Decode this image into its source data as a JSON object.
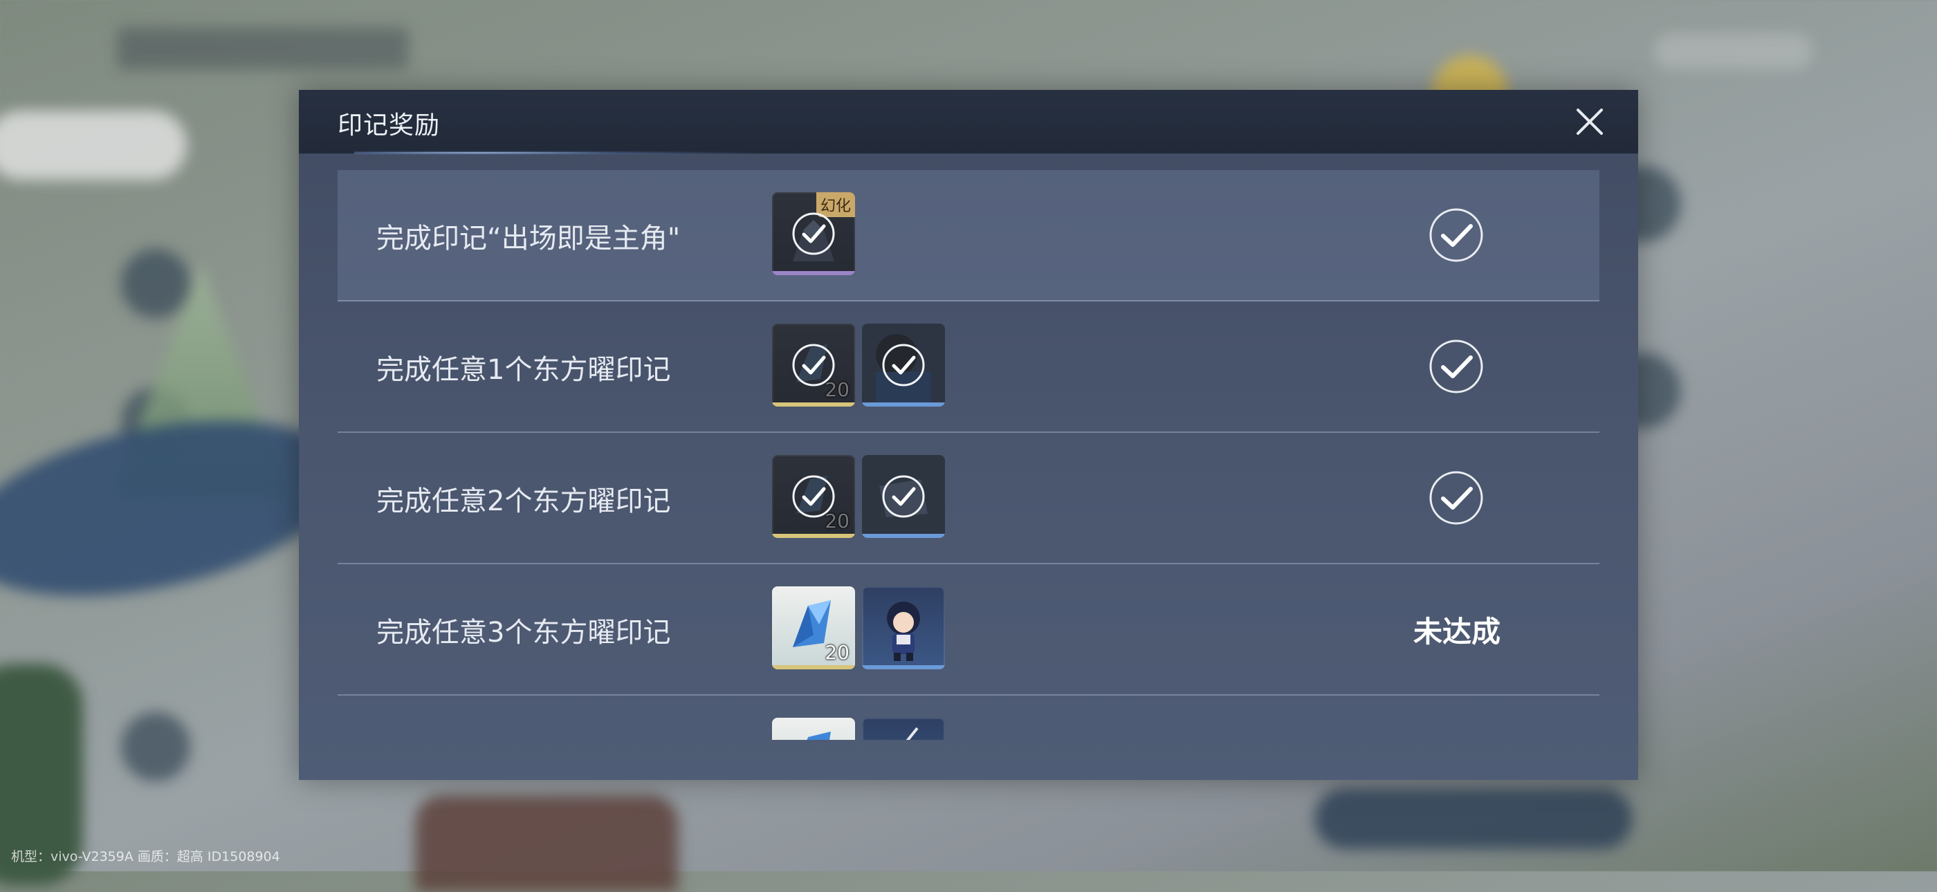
{
  "footer": {
    "meta": "机型：vivo-V2359A 画质：超高 ID1508904"
  },
  "dialog": {
    "title": "印记奖励",
    "close_icon": "close-icon"
  },
  "rows": [
    {
      "label": "完成印记“出场即是主角\"",
      "status": "claimed",
      "items": [
        {
          "kind": "appearance",
          "tag": "幻化",
          "quantity": "",
          "claimed": true
        }
      ]
    },
    {
      "label": "完成任意1个东方曜印记",
      "status": "claimed",
      "items": [
        {
          "kind": "crystal",
          "tag": "",
          "quantity": "20",
          "claimed": true
        },
        {
          "kind": "avatar",
          "tag": "",
          "quantity": "",
          "claimed": true
        }
      ]
    },
    {
      "label": "完成任意2个东方曜印记",
      "status": "claimed",
      "items": [
        {
          "kind": "crystal",
          "tag": "",
          "quantity": "20",
          "claimed": true
        },
        {
          "kind": "frame",
          "tag": "",
          "quantity": "",
          "claimed": true
        }
      ]
    },
    {
      "label": "完成任意3个东方曜印记",
      "status": "未达成",
      "items": [
        {
          "kind": "crystal",
          "tag": "",
          "quantity": "20",
          "claimed": false
        },
        {
          "kind": "chibi",
          "tag": "",
          "quantity": "",
          "claimed": false
        }
      ]
    },
    {
      "label": "",
      "status": "",
      "items": [
        {
          "kind": "crystal",
          "tag": "",
          "quantity": "",
          "claimed": false
        },
        {
          "kind": "wand",
          "tag": "",
          "quantity": "",
          "claimed": false
        }
      ]
    }
  ],
  "colors": {
    "dialog_bg": "#4a566e",
    "header_bg": "#232b3a",
    "status_text": "#ffffff",
    "label_text": "#e6eaf1",
    "quality_gold": "#d8c57a",
    "quality_blue": "#6b9ad8"
  }
}
